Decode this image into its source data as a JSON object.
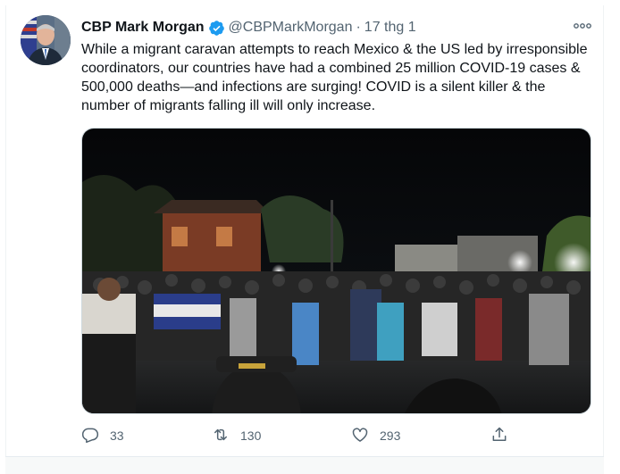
{
  "tweet": {
    "author_name": "CBP Mark Morgan",
    "handle": "@CBPMarkMorgan",
    "separator": "·",
    "timestamp": "17 thg 1",
    "text": "While a migrant caravan attempts to reach Mexico & the US led by irresponsible coordinators, our countries have had a combined 25 million COVID-19 cases & 500,000 deaths—and infections are surging! COVID is a silent killer & the number of migrants falling ill will only increase.",
    "icons": {
      "verified": "verified-badge-icon",
      "more": "more-options-icon"
    }
  },
  "actions": {
    "reply": {
      "icon": "reply-icon",
      "count": "33"
    },
    "retweet": {
      "icon": "retweet-icon",
      "count": "130"
    },
    "like": {
      "icon": "like-icon",
      "count": "293"
    },
    "share": {
      "icon": "share-icon"
    }
  },
  "colors": {
    "text": "#0f1419",
    "muted": "#536471",
    "verified": "#1d9bf0",
    "border": "#cfd9de"
  }
}
